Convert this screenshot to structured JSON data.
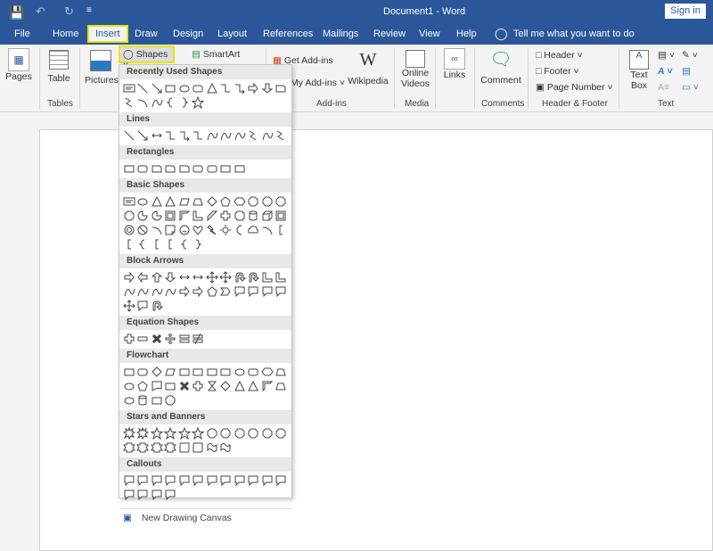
{
  "title": "Document1  -  Word",
  "sign_in": "Sign in",
  "tabs": [
    "File",
    "Home",
    "Insert",
    "Draw",
    "Design",
    "Layout",
    "References",
    "Mailings",
    "Review",
    "View",
    "Help"
  ],
  "tell_me": "Tell me what you want to do",
  "ribbon": {
    "pages": "Pages",
    "table": "Table",
    "tables_group": "Tables",
    "pictures": "Pictures",
    "shapes": "Shapes",
    "smartart": "SmartArt",
    "get_addins": "Get Add-ins",
    "my_addins": "My Add-ins",
    "wikipedia": "Wikipedia",
    "addins_group": "Add-ins",
    "online": "Online",
    "videos": "Videos",
    "media_group": "Media",
    "links": "Links",
    "comment": "Comment",
    "comments_group": "Comments",
    "header": "Header",
    "footer": "Footer",
    "page_number": "Page Number",
    "hf_group": "Header & Footer",
    "text": "Text",
    "box": "Box",
    "text_group": "Text"
  },
  "menu": {
    "sections": [
      {
        "title": "Recently Used Shapes",
        "shapes": [
          "textbox",
          "line",
          "arrow",
          "rect",
          "ellipse",
          "roundrect",
          "triangle",
          "elbow",
          "elbow-arrow",
          "right-arrow",
          "down-arrow",
          "snip",
          "freeform",
          "arc",
          "curve",
          "brace-left",
          "brace-right",
          "star"
        ]
      },
      {
        "title": "Lines",
        "shapes": [
          "line",
          "arrow",
          "double-arrow",
          "elbow",
          "elbow-arrow",
          "elbow",
          "curve",
          "curve",
          "curve",
          "freeform",
          "curve",
          "freeform"
        ]
      },
      {
        "title": "Rectangles",
        "shapes": [
          "rect",
          "roundrect",
          "snip",
          "snip",
          "snip",
          "roundrect",
          "roundrect",
          "rect",
          "rect"
        ]
      },
      {
        "title": "Basic Shapes",
        "shapes": [
          "textbox",
          "ellipse",
          "triangle",
          "triangle",
          "parallelogram",
          "trapezoid",
          "diamond",
          "pentagon",
          "hexagon",
          "octagon",
          "octagon",
          "octagon",
          "octagon",
          "pie",
          "pie",
          "frame",
          "halfframe",
          "corner",
          "diagonal",
          "cross",
          "plaque",
          "can",
          "cube",
          "bevel",
          "donut",
          "nosymbol",
          "arc",
          "fold",
          "smiley",
          "heart",
          "bolt",
          "sun",
          "moon",
          "cloud",
          "arc",
          "bracket",
          "bracket",
          "brace-left",
          "bracket",
          "bracket",
          "brace-left",
          "brace-right"
        ]
      },
      {
        "title": "Block Arrows",
        "shapes": [
          "right-arrow",
          "left-arrow",
          "up-arrow",
          "down-arrow",
          "double-arrow",
          "double-arrow",
          "quad-arrow",
          "quad-arrow",
          "uturn",
          "uturn",
          "corner",
          "corner",
          "curve",
          "curve",
          "curve",
          "curve",
          "right-arrow",
          "right-arrow",
          "pentagon",
          "chevron",
          "callout",
          "callout",
          "callout",
          "callout",
          "quad-arrow",
          "callout",
          "uturn"
        ]
      },
      {
        "title": "Equation Shapes",
        "shapes": [
          "plus",
          "minus",
          "times",
          "divide",
          "equal",
          "notequal"
        ]
      },
      {
        "title": "Flowchart",
        "shapes": [
          "rect",
          "roundrect",
          "diamond",
          "parallelogram",
          "rect",
          "rect",
          "rect",
          "rect",
          "ellipse",
          "roundrect",
          "hexagon",
          "trapezoid",
          "ellipse",
          "pentagon",
          "doc",
          "rect",
          "times",
          "plus",
          "hourglass",
          "diamond",
          "triangle",
          "triangle",
          "halfframe",
          "trapezoid",
          "ellipse",
          "can",
          "rect",
          "octagon"
        ]
      },
      {
        "title": "Stars and Banners",
        "shapes": [
          "explosion",
          "explosion",
          "star",
          "star",
          "star",
          "star",
          "octagon",
          "octagon",
          "octagon",
          "octagon",
          "octagon",
          "octagon",
          "ribbon",
          "ribbon",
          "ribbon",
          "ribbon",
          "scroll",
          "scroll",
          "wave",
          "wave"
        ]
      },
      {
        "title": "Callouts",
        "shapes": [
          "callout",
          "callout",
          "callout",
          "callout",
          "callout",
          "callout",
          "callout",
          "callout",
          "callout",
          "callout",
          "callout",
          "callout",
          "callout",
          "callout",
          "callout",
          "callout"
        ]
      }
    ],
    "new_canvas": "New Drawing Canvas"
  },
  "colors": {
    "brand": "#2b579a",
    "highlight": "#e6e600"
  }
}
